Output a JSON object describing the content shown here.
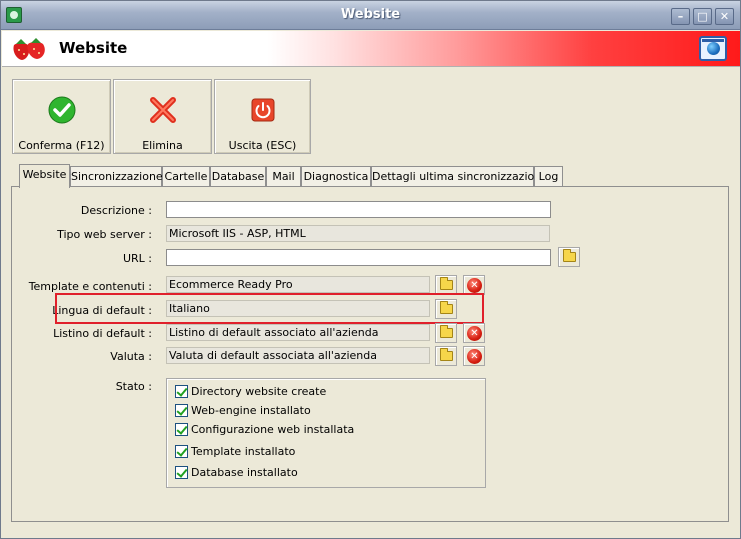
{
  "window": {
    "title": "Website"
  },
  "header": {
    "title": "Website",
    "logo_icon": "strawberries-icon",
    "right_icon": "globe-icon"
  },
  "toolbar": [
    {
      "label": "Conferma (F12)",
      "icon": "check-icon"
    },
    {
      "label": "Elimina",
      "icon": "delete-x-icon"
    },
    {
      "label": "Uscita (ESC)",
      "icon": "power-icon"
    }
  ],
  "tabs": [
    "Website",
    "Sincronizzazione",
    "Cartelle",
    "Database",
    "Mail",
    "Diagnostica",
    "Dettagli ultima sincronizzazione",
    "Log"
  ],
  "form": {
    "descrizione": {
      "label": "Descrizione :",
      "value": ""
    },
    "tipo_web_server": {
      "label": "Tipo web server :",
      "value": "Microsoft IIS - ASP, HTML"
    },
    "url": {
      "label": "URL :",
      "value": ""
    },
    "template": {
      "label": "Template e contenuti :",
      "value": "Ecommerce Ready Pro"
    },
    "lingua": {
      "label": "Lingua di default :",
      "value": "Italiano"
    },
    "listino": {
      "label": "Listino di default :",
      "value": "Listino di default associato all'azienda"
    },
    "valuta": {
      "label": "Valuta :",
      "value": "Valuta di default associata all'azienda"
    }
  },
  "stato": {
    "label": "Stato :",
    "items": [
      {
        "label": "Directory website create",
        "checked": true
      },
      {
        "label": "Web-engine installato",
        "checked": true
      },
      {
        "label": "Configurazione web installata",
        "checked": true
      },
      {
        "label": "Template installato",
        "checked": true
      },
      {
        "label": "Database installato",
        "checked": true
      }
    ]
  },
  "colors": {
    "header_accent": "#ff1a1a",
    "highlight_box": "#e0202b"
  }
}
